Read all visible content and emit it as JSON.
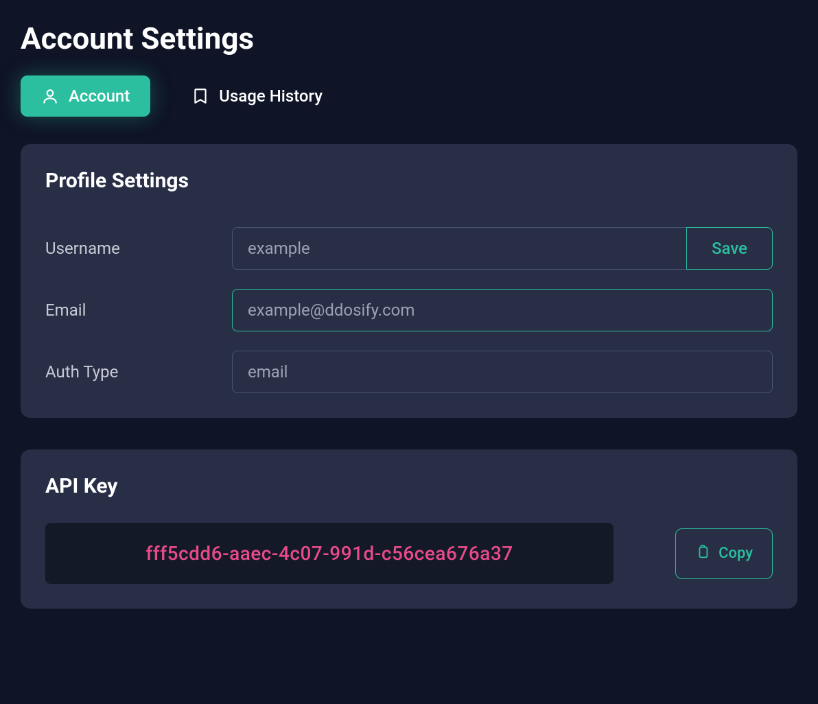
{
  "page_title": "Account Settings",
  "tabs": {
    "account": {
      "label": "Account",
      "active": true
    },
    "usage_history": {
      "label": "Usage History",
      "active": false
    }
  },
  "profile_settings": {
    "title": "Profile Settings",
    "username": {
      "label": "Username",
      "value": "example",
      "save_label": "Save"
    },
    "email": {
      "label": "Email",
      "value": "example@ddosify.com"
    },
    "auth_type": {
      "label": "Auth Type",
      "value": "email"
    }
  },
  "api_key": {
    "title": "API Key",
    "value": "fff5cdd6-aaec-4c07-991d-c56cea676a37",
    "copy_label": "Copy"
  },
  "colors": {
    "accent": "#2bbfa0",
    "pink": "#e94b8a",
    "card_bg": "#272e46",
    "page_bg": "#0f1426"
  }
}
